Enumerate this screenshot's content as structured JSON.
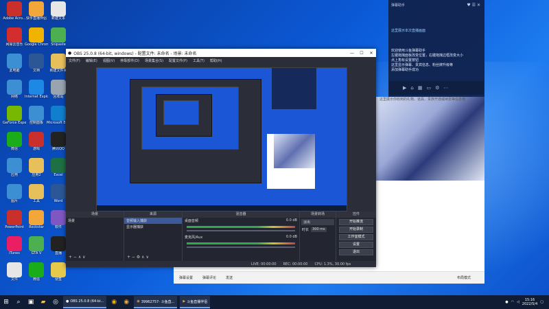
{
  "desktop_icons": [
    {
      "name": "adobe-acrobat-icon",
      "label": "Adobe Acro...",
      "color": "#c9302c"
    },
    {
      "name": "kuaishou-icon",
      "label": "快手直播伴侣",
      "color": "#f3a63a"
    },
    {
      "name": "doc-icon",
      "label": "新建文本",
      "color": "#e6e6e6"
    },
    {
      "name": "netease-music-icon",
      "label": "网易云音乐",
      "color": "#d42d2d"
    },
    {
      "name": "chrome-icon",
      "label": "Google Chrome",
      "color": "#f0b400"
    },
    {
      "name": "screenshot-icon",
      "label": "Snipaste",
      "color": "#4caf50"
    },
    {
      "name": "computer-icon",
      "label": "此电脑",
      "color": "#3d8fd4"
    },
    {
      "name": "word-doc-icon",
      "label": "文档",
      "color": "#2b5797"
    },
    {
      "name": "folder-icon",
      "label": "新建文件夹",
      "color": "#e8c05b"
    },
    {
      "name": "network-icon",
      "label": "网络",
      "color": "#3d8fd4"
    },
    {
      "name": "ie-icon",
      "label": "Internet Explorer",
      "color": "#1e88e5"
    },
    {
      "name": "recycle-icon",
      "label": "回收站",
      "color": "#9aa4b0"
    },
    {
      "name": "nvidia-icon",
      "label": "GeForce Experience",
      "color": "#76b900"
    },
    {
      "name": "control-icon",
      "label": "控制面板",
      "color": "#3d8fd4"
    },
    {
      "name": "edge-icon",
      "label": "Microsoft Edge",
      "color": "#0f7fce"
    },
    {
      "name": "wechat-icon",
      "label": "微信",
      "color": "#1aad19"
    },
    {
      "name": "game-icon",
      "label": "游戏",
      "color": "#c9302c"
    },
    {
      "name": "qq-icon",
      "label": "腾讯QQ",
      "color": "#222"
    },
    {
      "name": "app-icon",
      "label": "应用",
      "color": "#3d8fd4"
    },
    {
      "name": "app2-icon",
      "label": "应用2",
      "color": "#e8c05b"
    },
    {
      "name": "excel-icon",
      "label": "Excel",
      "color": "#1d7044"
    },
    {
      "name": "img-icon",
      "label": "图片",
      "color": "#3d8fd4"
    },
    {
      "name": "tool-icon",
      "label": "工具",
      "color": "#e8c05b"
    },
    {
      "name": "word-icon",
      "label": "Word",
      "color": "#2b5797"
    },
    {
      "name": "ppt-icon",
      "label": "PowerPoint",
      "color": "#c9302c"
    },
    {
      "name": "rockstar-icon",
      "label": "Rockstar",
      "color": "#f3a63a"
    },
    {
      "name": "arrow-icon",
      "label": "软件",
      "color": "#7e57c2"
    },
    {
      "name": "itunes-icon",
      "label": "iTunes",
      "color": "#e91e63"
    },
    {
      "name": "gta-icon",
      "label": "GTA V",
      "color": "#4caf50"
    },
    {
      "name": "stream-icon",
      "label": "直播",
      "color": "#222"
    },
    {
      "name": "file-icon",
      "label": "文件",
      "color": "#e6e6e6"
    },
    {
      "name": "green-app-icon",
      "label": "微信",
      "color": "#1aad19"
    },
    {
      "name": "note-icon",
      "label": "便签",
      "color": "#e6c84a"
    },
    {
      "name": "g-icon",
      "label": "Logitech",
      "color": "#222"
    }
  ],
  "obs": {
    "title": "OBS 25.0.8 (64-bit, windows) - 配置文件: 未命名 - 场景: 未命名",
    "menu": [
      "文件(F)",
      "编辑(E)",
      "视图(V)",
      "停靠部件(D)",
      "场景集合(S)",
      "配置文件(P)",
      "工具(T)",
      "帮助(H)"
    ],
    "docks": {
      "scenes": {
        "title": "场景",
        "items": [
          "场景"
        ]
      },
      "sources": {
        "title": "来源",
        "items": [
          "音频输入捕获",
          "显示器捕获"
        ]
      },
      "mixer": {
        "title": "混音器",
        "tracks": [
          {
            "name": "桌面音频",
            "db": "0.0 dB"
          },
          {
            "name": "麦克风/Aux",
            "db": "0.0 dB"
          }
        ]
      },
      "transitions": {
        "title": "场景转场",
        "mode": "淡出",
        "duration_label": "时长",
        "duration": "300 ms"
      },
      "controls": {
        "title": "控件",
        "buttons": [
          "开始推流",
          "开始录制",
          "工作室模式",
          "设置",
          "退出"
        ]
      }
    },
    "status": {
      "live": "LIVE: 00:00:00",
      "rec": "REC: 00:00:00",
      "cpu": "CPU: 1.3%, 30.00 fps"
    }
  },
  "chat_panel": {
    "header": "弹幕助手",
    "messages": [
      "这里展示本次直播画面",
      "欢迎使用斗鱼弹幕助手",
      "左键拖拽面板改变位置，右键拖拽边框改变大小",
      "点上角有设置按钮",
      "这里显示弹幕、贵宾信息、粉丝牌升级等",
      "添加弹幕助手成功"
    ],
    "gift_text": "这里展示你收到的礼物、道具、贵族开通或续费等信息哦"
  },
  "browser": {
    "toolbar": [
      "弹幕设置",
      "弹幕评论",
      "发送"
    ],
    "right_tools": [
      "布局模式"
    ]
  },
  "taskbar": {
    "apps": [
      {
        "name": "taskbar-obs",
        "label": "OBS 25.0.8 (64-bi..."
      },
      {
        "name": "taskbar-browser",
        "label": "39962757- 斗鱼直..."
      },
      {
        "name": "taskbar-live",
        "label": "斗鱼直播伴侣"
      }
    ],
    "time": "15:16",
    "date": "2022/5/4"
  }
}
